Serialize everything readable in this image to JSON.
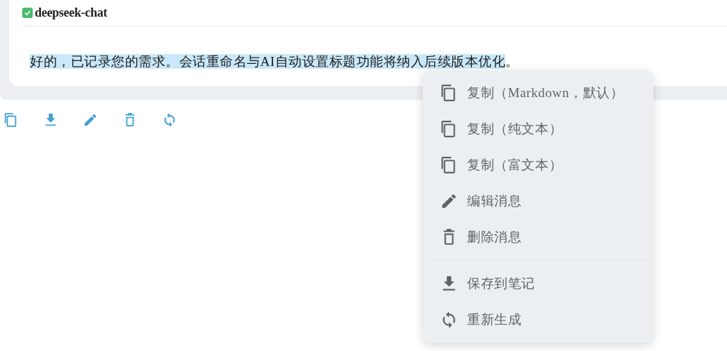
{
  "message": {
    "model": "deepseek-chat",
    "body": [
      {
        "text": "好的，已记录您的需求。会话重命名与AI自动设置标题功能将纳入后续版本优化",
        "selected": true
      },
      {
        "text": "。",
        "selected": false
      }
    ]
  },
  "actions": [
    {
      "kind": "copy"
    },
    {
      "kind": "save"
    },
    {
      "kind": "edit"
    },
    {
      "kind": "delete"
    },
    {
      "kind": "regenerate"
    }
  ],
  "context_menu": {
    "groups": [
      [
        {
          "kind": "copy",
          "label": "复制（Markdown，默认）"
        },
        {
          "kind": "copy",
          "label": "复制（纯文本）"
        },
        {
          "kind": "copy",
          "label": "复制（富文本）"
        },
        {
          "kind": "edit",
          "label": "编辑消息"
        },
        {
          "kind": "delete",
          "label": "删除消息"
        }
      ],
      [
        {
          "kind": "save",
          "label": "保存到笔记"
        },
        {
          "kind": "regenerate",
          "label": "重新生成"
        }
      ]
    ]
  }
}
